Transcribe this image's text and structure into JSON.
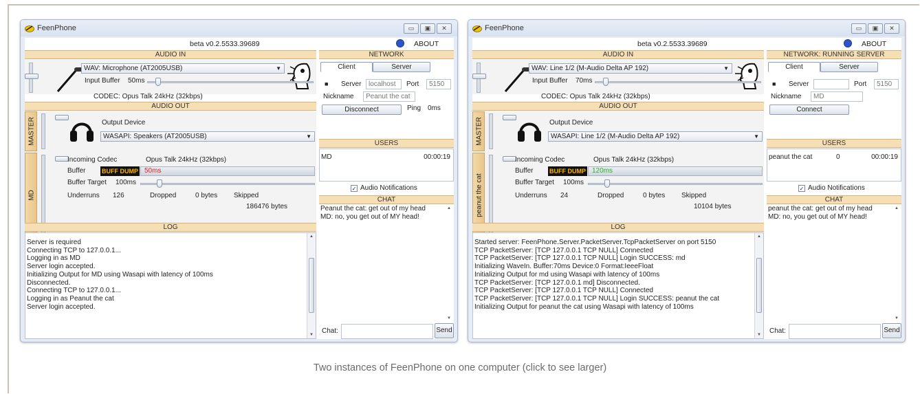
{
  "caption": "Two instances of FeenPhone on one computer (click to see larger)",
  "windows": [
    {
      "title": "FeenPhone",
      "version": "beta v0.2.5533.39689",
      "about": "ABOUT",
      "audio_in": {
        "header": "AUDIO IN",
        "device": "WAV: Microphone (AT2005USB)",
        "input_buffer_label": "Input Buffer",
        "input_buffer_value": "50ms",
        "codec": "CODEC: Opus Talk 24kHz (32kbps)"
      },
      "audio_out": {
        "header": "AUDIO OUT",
        "master_tab": "MASTER",
        "output_device_label": "Output Device",
        "output_device": "WASAPI: Speakers (AT2005USB)",
        "user_tab": "MD",
        "incoming_codec_label": "Incoming Codec",
        "incoming_codec_value": "Opus Talk 24kHz (32kbps)",
        "buffer_label": "Buffer",
        "buff_dump": "BUFF DUMP",
        "buffer_value": "50ms",
        "buffer_target_label": "Buffer Target",
        "buffer_target_value": "100ms",
        "underruns_label": "Underruns",
        "underruns_value": "126",
        "dropped_label": "Dropped",
        "dropped_value": "0 bytes",
        "skipped_label": "Skipped",
        "skipped_value": "186476 bytes"
      },
      "network": {
        "header": "NETWORK",
        "tab_client": "Client",
        "tab_server": "Server",
        "server_label": "Server",
        "server_value": "localhost",
        "port_label": "Port",
        "port_value": "5150",
        "nickname_label": "Nickname",
        "nickname_value": "Peanut the cat",
        "connect_button": "Disconnect",
        "ping_label": "Ping",
        "ping_value": "0ms"
      },
      "users": {
        "header": "USERS",
        "rows": [
          {
            "name": "MD",
            "level": "",
            "time": "00:00:19"
          }
        ]
      },
      "audio_notifications": "Audio Notifications",
      "chat": {
        "header": "CHAT",
        "messages": [
          "Peanut the cat: get out of my head",
          "MD: no, you get out of MY head!"
        ],
        "input_label": "Chat:",
        "send": "Send"
      },
      "log": {
        "header": "LOG",
        "lines": [
          "Server is required",
          "Connecting TCP to 127.0.0.1...",
          "Logging in as MD",
          "Server login accepted.",
          "Initializing Output for MD using Wasapi with latency of 100ms",
          "Disconnected.",
          "Connecting TCP to 127.0.0.1...",
          "Logging in as Peanut the cat",
          "Server login accepted."
        ]
      }
    },
    {
      "title": "FeenPhone",
      "version": "beta v0.2.5533.39689",
      "about": "ABOUT",
      "audio_in": {
        "header": "AUDIO IN",
        "device": "WAV: Line 1/2 (M-Audio Delta AP 192)",
        "input_buffer_label": "Input Buffer",
        "input_buffer_value": "70ms",
        "codec": "CODEC: Opus Talk 24kHz (32kbps)"
      },
      "audio_out": {
        "header": "AUDIO OUT",
        "master_tab": "MASTER",
        "output_device_label": "Output Device",
        "output_device": "WASAPI: Line 1/2 (M-Audio Delta AP 192)",
        "user_tab": "peanut the cat",
        "incoming_codec_label": "Incoming Codec",
        "incoming_codec_value": "Opus Talk 24kHz (32kbps)",
        "buffer_label": "Buffer",
        "buff_dump": "BUFF DUMP",
        "buffer_value": "120ms",
        "buffer_target_label": "Buffer Target",
        "buffer_target_value": "100ms",
        "underruns_label": "Underruns",
        "underruns_value": "24",
        "dropped_label": "Dropped",
        "dropped_value": "0 bytes",
        "skipped_label": "Skipped",
        "skipped_value": "10104 bytes"
      },
      "network": {
        "header": "NETWORK: RUNNING SERVER",
        "tab_client": "Client",
        "tab_server": "Server",
        "server_label": "Server",
        "server_value": "",
        "port_label": "Port",
        "port_value": "5150",
        "nickname_label": "Nickname",
        "nickname_value": "MD",
        "connect_button": "Connect",
        "ping_label": "",
        "ping_value": ""
      },
      "users": {
        "header": "USERS",
        "rows": [
          {
            "name": "peanut the cat",
            "level": "0",
            "time": "00:00:19"
          }
        ]
      },
      "audio_notifications": "Audio Notifications",
      "chat": {
        "header": "CHAT",
        "messages": [
          "peanut the cat: get out of my head",
          "MD: no, you get out of MY head!"
        ],
        "input_label": "Chat:",
        "send": "Send"
      },
      "log": {
        "header": "LOG",
        "lines": [
          "Started server: FeenPhone.Server.PacketServer.TcpPacketServer on port 5150",
          "TCP PacketServer: [TCP 127.0.0.1 TCP NULL] Connected",
          "TCP PacketServer: [TCP 127.0.0.1 TCP NULL] Login SUCCESS: md",
          "Initializing WaveIn. Buffer:70ms Device:0 Format:IeeeFloat",
          "Initializing Output for md using Wasapi with latency of 100ms",
          "TCP PacketServer: [TCP 127.0.0.1 md] Disconnected.",
          "TCP PacketServer: [TCP 127.0.0.1 TCP NULL] Connected",
          "TCP PacketServer: [TCP 127.0.0.1 TCP NULL] Login SUCCESS: peanut the cat",
          "Initializing Output for peanut the cat using Wasapi with latency of 100ms"
        ]
      }
    }
  ]
}
